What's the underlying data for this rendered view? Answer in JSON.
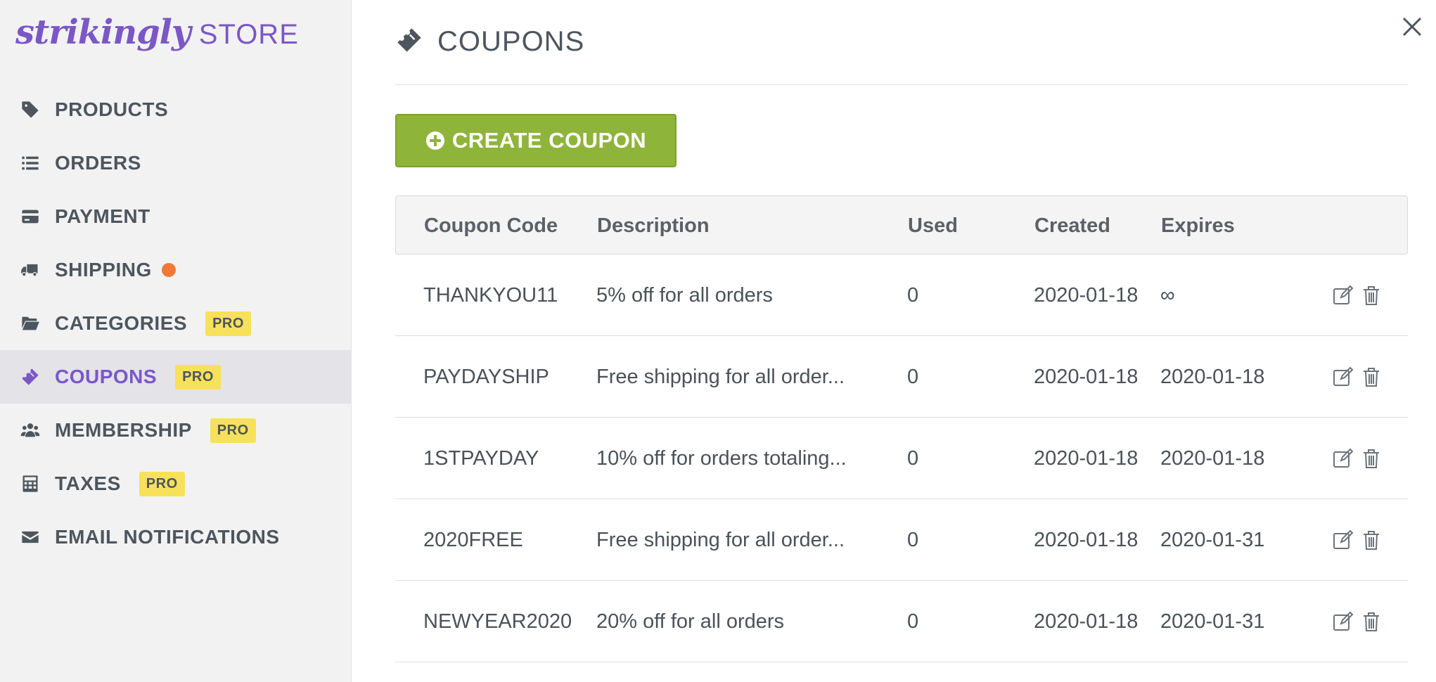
{
  "logo": {
    "word": "strikingly",
    "store": "STORE"
  },
  "nav": [
    {
      "label": "PRODUCTS",
      "icon": "tag-icon"
    },
    {
      "label": "ORDERS",
      "icon": "list-icon"
    },
    {
      "label": "PAYMENT",
      "icon": "credit-card-icon"
    },
    {
      "label": "SHIPPING",
      "icon": "truck-icon",
      "dot": true
    },
    {
      "label": "CATEGORIES",
      "icon": "folder-open-icon",
      "badge": "PRO"
    },
    {
      "label": "COUPONS",
      "icon": "ticket-icon",
      "badge": "PRO",
      "active": true
    },
    {
      "label": "MEMBERSHIP",
      "icon": "users-icon",
      "badge": "PRO"
    },
    {
      "label": "TAXES",
      "icon": "calculator-icon",
      "badge": "PRO"
    },
    {
      "label": "EMAIL NOTIFICATIONS",
      "icon": "envelope-icon"
    }
  ],
  "page": {
    "title": "COUPONS"
  },
  "create_button": {
    "label": "CREATE COUPON"
  },
  "table": {
    "headers": {
      "code": "Coupon Code",
      "description": "Description",
      "used": "Used",
      "created": "Created",
      "expires": "Expires"
    },
    "rows": [
      {
        "code": "THANKYOU11",
        "description": "5% off for all orders",
        "used": "0",
        "created": "2020-01-18",
        "expires": "∞"
      },
      {
        "code": "PAYDAYSHIP",
        "description": "Free shipping for all order...",
        "used": "0",
        "created": "2020-01-18",
        "expires": "2020-01-18"
      },
      {
        "code": "1STPAYDAY",
        "description": "10% off for orders totaling...",
        "used": "0",
        "created": "2020-01-18",
        "expires": "2020-01-18"
      },
      {
        "code": "2020FREE",
        "description": "Free shipping for all order...",
        "used": "0",
        "created": "2020-01-18",
        "expires": "2020-01-31"
      },
      {
        "code": "NEWYEAR2020",
        "description": "20% off for all orders",
        "used": "0",
        "created": "2020-01-18",
        "expires": "2020-01-31"
      }
    ]
  },
  "colors": {
    "brand": "#7b57c6",
    "button": "#8fb43a",
    "pro_badge": "#f7e15a",
    "notification_dot": "#ee7a35"
  }
}
